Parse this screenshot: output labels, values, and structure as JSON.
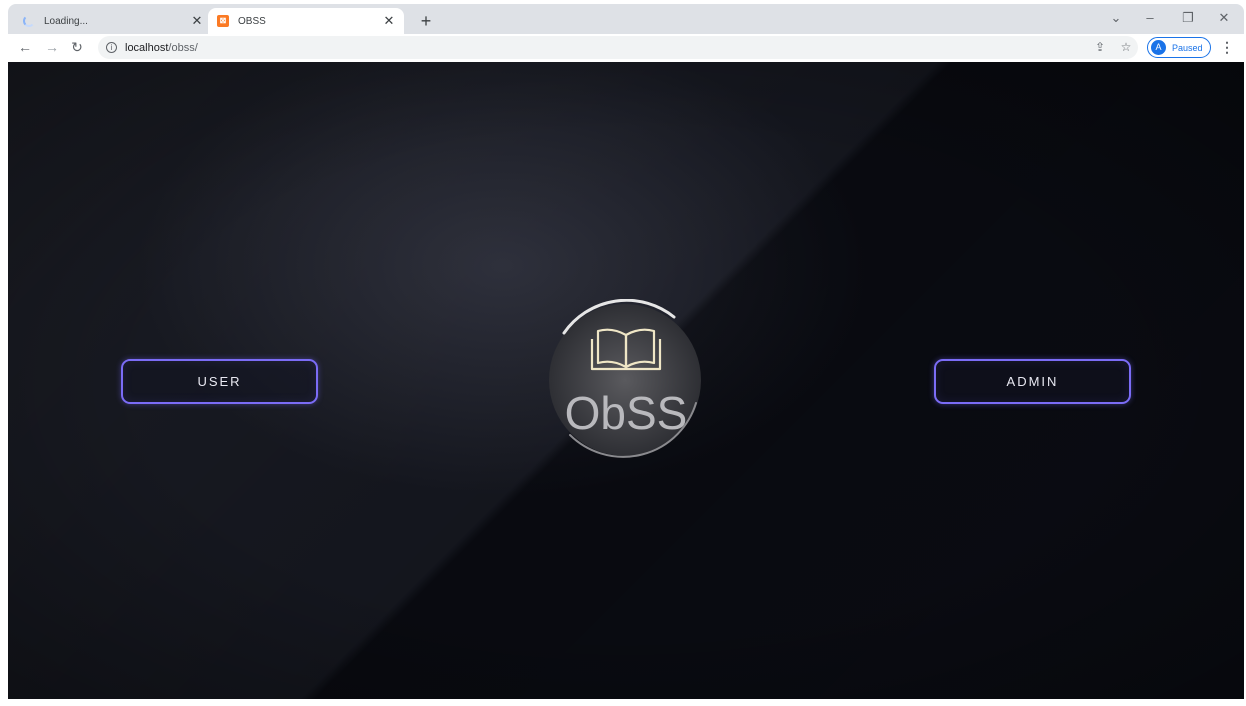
{
  "browser": {
    "tabs": [
      {
        "title": "Loading...",
        "favicon": "loading-spinner-icon",
        "active": false
      },
      {
        "title": "OBSS",
        "favicon": "xampp-icon",
        "active": true
      }
    ],
    "new_tab_symbol": "+",
    "url_host": "localhost",
    "url_path": "/obss/",
    "profile_initial": "A",
    "profile_status": "Paused",
    "accent_color": "#1a73e8"
  },
  "page": {
    "user_button": "USER",
    "admin_button": "ADMIN",
    "logo_text": "ObSS",
    "button_border_color": "#7b6cf6",
    "background_color": "#0c0e16",
    "logo_icon": "open-book-icon"
  }
}
